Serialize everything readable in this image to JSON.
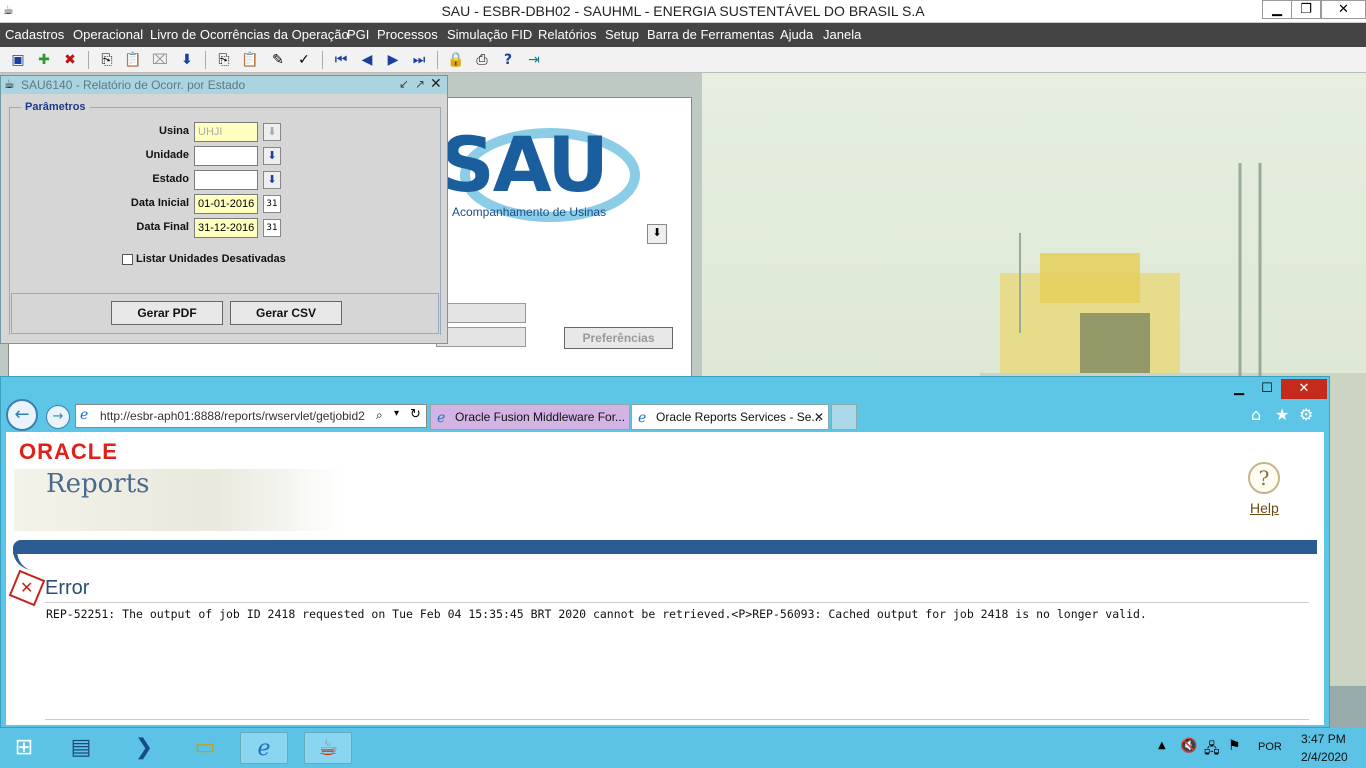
{
  "app": {
    "title": "SAU - ESBR-DBH02 - SAUHML - ENERGIA SUSTENTÁVEL DO BRASIL S.A",
    "win_min": "▁",
    "win_max": "❐",
    "win_close": "✕"
  },
  "menu": [
    "Cadastros",
    "Operacional",
    "Livro de Ocorrências da Operação",
    "PGI",
    "Processos",
    "Simulação FID",
    "Relatórios",
    "Setup",
    "Barra de Ferramentas",
    "Ajuda",
    "Janela"
  ],
  "toolbar": {
    "icons": [
      "save-icon",
      "add-icon",
      "delete-icon",
      "copy-record-icon",
      "paste-record-icon",
      "clear-icon",
      "down-arrow-icon",
      "copy-icon",
      "paste-icon",
      "edit-icon",
      "spellcheck-icon",
      "first-record-icon",
      "previous-record-icon",
      "next-record-icon",
      "last-record-icon",
      "lock-icon",
      "print-icon",
      "help-icon",
      "exit-icon"
    ]
  },
  "background_form": {
    "logo_text": "SAU",
    "logo_subtitle": "Acompanhamento de Usinas",
    "preferences_button": "Preferências"
  },
  "dialog": {
    "title": "SAU6140 - Relatório de Ocorr. por Estado",
    "group_label": "Parâmetros",
    "fields": {
      "usina_label": "Usina",
      "usina_value": "UHJI",
      "unidade_label": "Unidade",
      "unidade_value": "",
      "estado_label": "Estado",
      "estado_value": "",
      "data_inicial_label": "Data Inicial",
      "data_inicial_value": "01-01-2016",
      "data_final_label": "Data Final",
      "data_final_value": "31-12-2016"
    },
    "checkbox_label": "Listar Unidades Desativadas",
    "checkbox_checked": false,
    "gerar_pdf": "Gerar PDF",
    "gerar_csv": "Gerar CSV"
  },
  "browser": {
    "url": "http://esbr-aph01:8888/reports/rwservlet/getjobid2",
    "tabs": [
      "Oracle Fusion Middleware For...",
      "Oracle Reports Services - Se..."
    ],
    "tab_close": "✕",
    "oracle_logo": "ORACLE",
    "reports_title": "Reports",
    "help_label": "Help",
    "error_heading": "Error",
    "error_message": "REP-52251: The output of job ID 2418 requested on Tue Feb 04 15:35:45 BRT 2020 cannot be retrieved.<P>REP-56093: Cached output for job 2418 is no longer valid."
  },
  "taskbar": {
    "language": "POR",
    "time": "3:47 PM",
    "date": "2/4/2020"
  }
}
